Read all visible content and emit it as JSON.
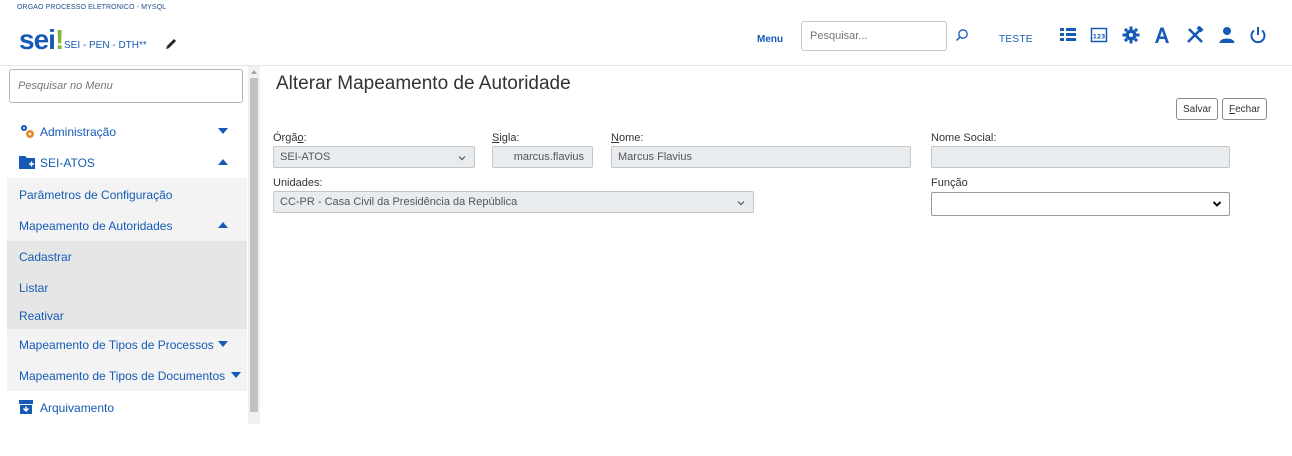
{
  "header": {
    "org_name": "ORGAO PROCESSO ELETRONICO - MYSQL",
    "logo_text": "sei",
    "logo_bang": "!",
    "system_name": "SEI - PEN - DTH**",
    "menu_label": "Menu",
    "search_placeholder": "Pesquisar...",
    "user_name": "TESTE",
    "icons": [
      "list-icon",
      "calendar-icon",
      "gear-icon",
      "font-icon",
      "tools-icon",
      "user-icon",
      "power-icon"
    ],
    "accent_color": "#155bb5"
  },
  "sidebar": {
    "search_placeholder": "Pesquisar no Menu",
    "items": [
      {
        "label": "Administração",
        "icon": "cogs-icon",
        "expanded": false
      },
      {
        "label": "SEI-ATOS",
        "icon": "folder-icon",
        "expanded": true
      },
      {
        "label": "Parâmetros de Configuração"
      },
      {
        "label": "Mapeamento de Autoridades",
        "expanded": true
      },
      {
        "label": "Cadastrar"
      },
      {
        "label": "Listar"
      },
      {
        "label": "Reativar"
      },
      {
        "label": "Mapeamento de Tipos de Processos",
        "expanded": false
      },
      {
        "label": "Mapeamento de Tipos de Documentos",
        "expanded": false
      },
      {
        "label": "Arquivamento",
        "icon": "archive-icon"
      }
    ]
  },
  "main": {
    "title": "Alterar Mapeamento de Autoridade",
    "buttons": {
      "save": "Salvar",
      "close_first": "F",
      "close_rest": "echar"
    },
    "form": {
      "orgao_label_pre": "Órgã",
      "orgao_label_u": "o",
      "orgao_label_post": ":",
      "orgao_value": "SEI-ATOS",
      "sigla_label_u": "S",
      "sigla_label_rest": "igla:",
      "sigla_value": "marcus.flavius",
      "nome_label_u": "N",
      "nome_label_rest": "ome:",
      "nome_value": "Marcus Flavius",
      "nome_social_label": "Nome Social:",
      "nome_social_value": "",
      "unidades_label": "Unidades:",
      "unidades_value": "CC-PR - Casa Civil da Presidência da República",
      "funcao_label": "Função",
      "funcao_value": ""
    }
  }
}
